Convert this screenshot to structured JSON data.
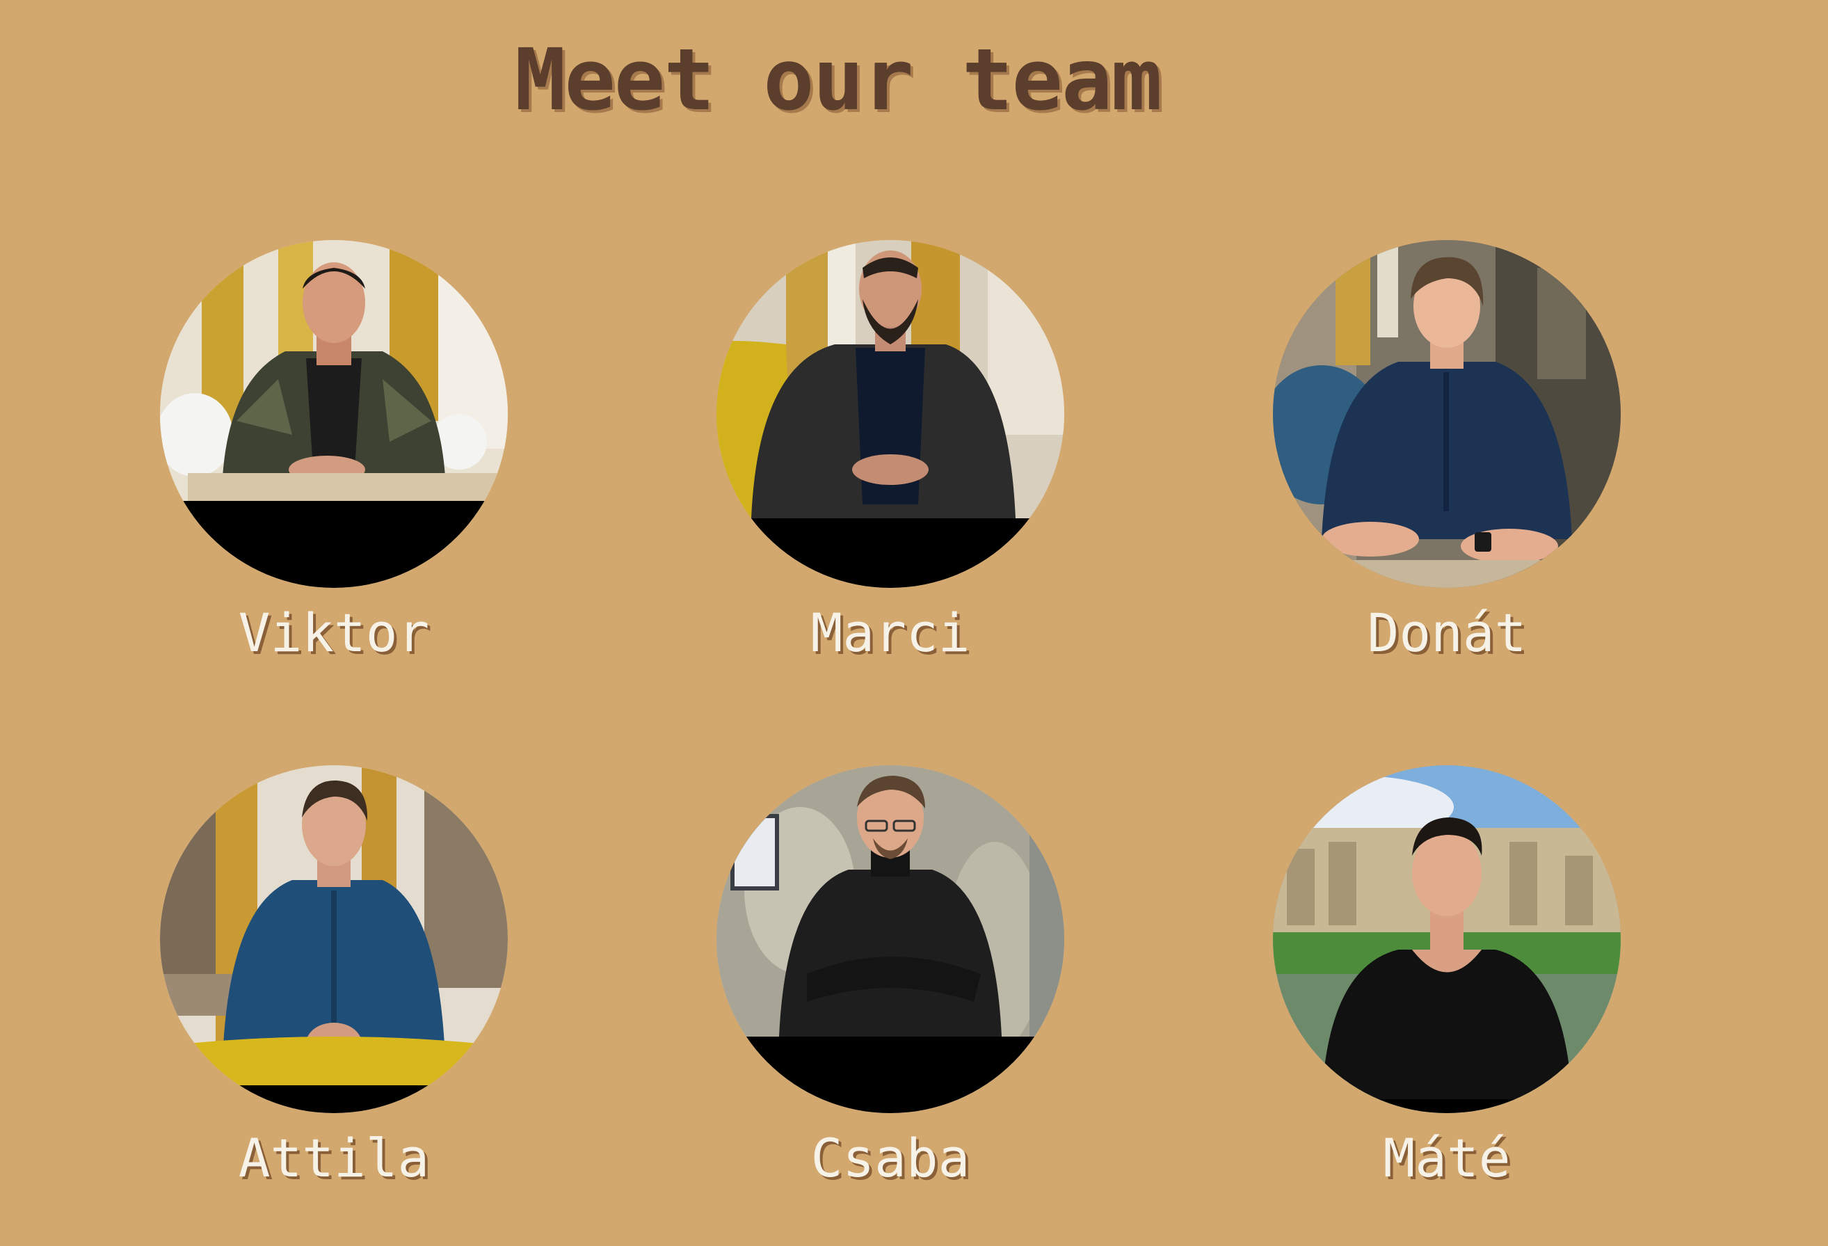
{
  "title": "Meet our team",
  "team": [
    {
      "name": "Viktor"
    },
    {
      "name": "Marci"
    },
    {
      "name": "Donát"
    },
    {
      "name": "Attila"
    },
    {
      "name": "Csaba"
    },
    {
      "name": "Máté"
    }
  ]
}
